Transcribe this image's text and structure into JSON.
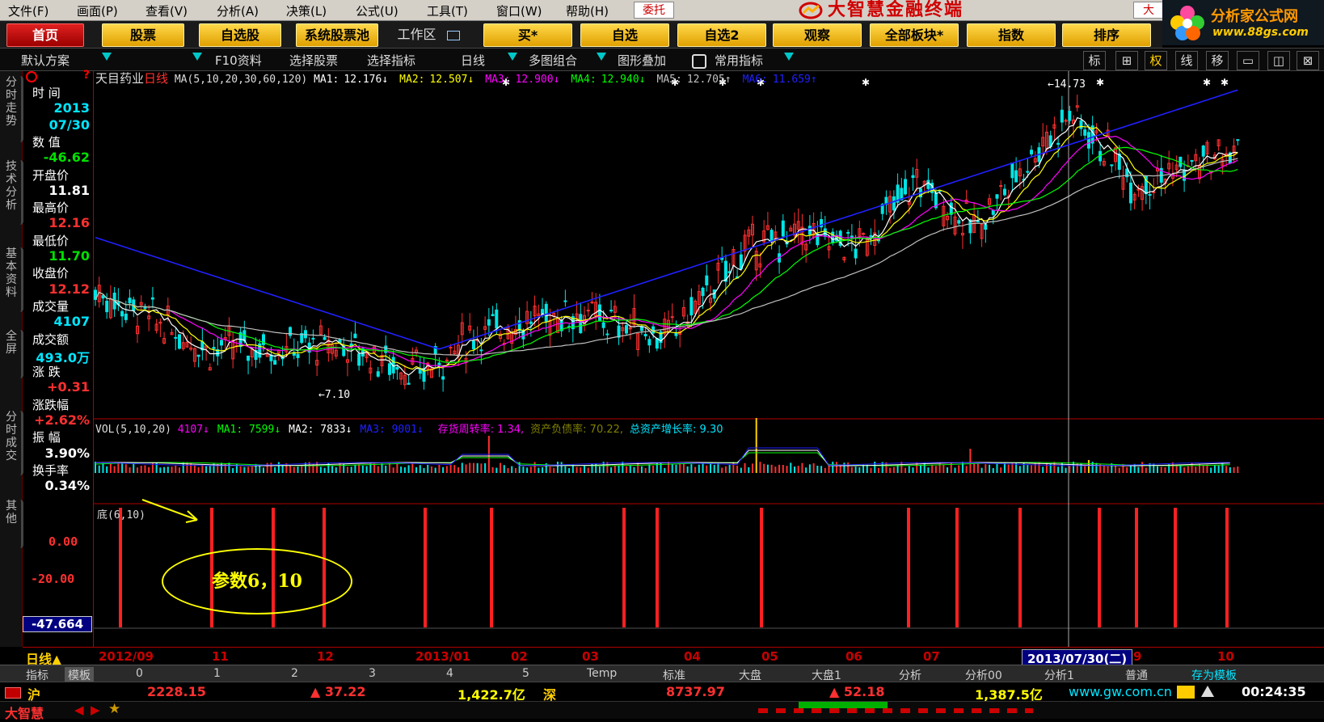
{
  "menu": [
    "文件(F)",
    "画面(P)",
    "查看(V)",
    "分析(A)",
    "决策(L)",
    "公式(U)",
    "工具(T)",
    "窗口(W)",
    "帮助(H)"
  ],
  "entrust_label": "委托",
  "brand_title": "大智慧金融终端",
  "corner_button": "大",
  "corner_logo": {
    "line1": "分析家公式网",
    "line2": "www.88gs.com"
  },
  "nav": {
    "home": "首页",
    "stocks": "股票",
    "watchlist": "自选股",
    "screener": "系统股票池",
    "workspace": "工作区",
    "buy": "买*",
    "self": "自选",
    "self2": "自选2",
    "watch": "观察",
    "sectors": "全部板块*",
    "index": "指数",
    "sort": "排序"
  },
  "toolbar": {
    "scheme": "默认方案",
    "f10": "F10资料",
    "select_stock": "选择股票",
    "select_indicator": "选择指标",
    "period": "日线",
    "multi": "多图组合",
    "overlay": "图形叠加",
    "common": "常用指标",
    "right_icons": [
      "标",
      "⊞",
      "权",
      "线",
      "移",
      "▭",
      "◫",
      "⊠"
    ]
  },
  "vtabs": [
    "分时走势",
    "技术分析",
    "基本资料",
    "全屏",
    "分时成交",
    "其他"
  ],
  "info": [
    {
      "label": "时  间",
      "value": ""
    },
    {
      "label": "",
      "value": "2013",
      "color": "#00e5ff"
    },
    {
      "label": "",
      "value": "07/30",
      "color": "#00e5ff"
    },
    {
      "label": "数  值",
      "value": ""
    },
    {
      "label": "",
      "value": "-46.62",
      "color": "#00e000"
    },
    {
      "label": "开盘价",
      "value": ""
    },
    {
      "label": "",
      "value": "11.81",
      "color": "#ffffff"
    },
    {
      "label": "最高价",
      "value": ""
    },
    {
      "label": "",
      "value": "12.16",
      "color": "#ff3030"
    },
    {
      "label": "最低价",
      "value": ""
    },
    {
      "label": "",
      "value": "11.70",
      "color": "#00e000"
    },
    {
      "label": "收盘价",
      "value": ""
    },
    {
      "label": "",
      "value": "12.12",
      "color": "#ff3030"
    },
    {
      "label": "成交量",
      "value": ""
    },
    {
      "label": "",
      "value": "4107",
      "color": "#00e5ff"
    },
    {
      "label": "成交额",
      "value": ""
    },
    {
      "label": "",
      "value": "493.0万",
      "color": "#00e5ff"
    },
    {
      "label": "涨  跌",
      "value": ""
    },
    {
      "label": "",
      "value": "+0.31",
      "color": "#ff3030"
    },
    {
      "label": "涨跌幅",
      "value": ""
    },
    {
      "label": "",
      "value": "+2.62%",
      "color": "#ff3030"
    },
    {
      "label": "振  幅",
      "value": "",
      "inline": true
    },
    {
      "label": "",
      "value": "3.90%",
      "color": "#ffffff"
    },
    {
      "label": "换手率",
      "value": ""
    },
    {
      "label": "",
      "value": "0.34%",
      "color": "#ffffff"
    }
  ],
  "chart": {
    "stock_name": "天目药业",
    "period": "日线",
    "ma_legend": "MA(5,10,20,30,60,120)",
    "ma_values": [
      {
        "label": "MA1:",
        "value": "12.176↓",
        "color": "#ffffff"
      },
      {
        "label": "MA2:",
        "value": "12.507↓",
        "color": "#ffff00"
      },
      {
        "label": "MA3:",
        "value": "12.900↓",
        "color": "#ff00ff"
      },
      {
        "label": "MA4:",
        "value": "12.940↓",
        "color": "#00ff00"
      },
      {
        "label": "MA5:",
        "value": "12.705↑",
        "color": "#c0c0c0"
      },
      {
        "label": "MA6:",
        "value": "11.659↑",
        "color": "#2020ff"
      }
    ],
    "high_mark": "14.73",
    "low_mark": "7.10",
    "vol_legend": "VOL(5,10,20)",
    "vol_values": [
      {
        "text": "4107↓",
        "color": "#ff00ff"
      },
      {
        "text": "MA1: 7599↓",
        "color": "#00ff00"
      },
      {
        "text": "MA2: 7833↓",
        "color": "#ffffff"
      },
      {
        "text": "MA3: 9001↓",
        "color": "#2020ff"
      }
    ],
    "fin_values": [
      {
        "text": "存货周转率: 1.34,",
        "color": "#ff00ff"
      },
      {
        "text": "资产负债率: 70.22,",
        "color": "#808000"
      },
      {
        "text": "总资产增长率: 9.30",
        "color": "#00e5ff"
      }
    ],
    "indicator_name": "底(6,10)",
    "indicator_ticks": [
      "0.00",
      "-20.00"
    ],
    "indicator_current": "-47.664",
    "annotation": "参数6，10"
  },
  "chart_data": {
    "type": "line",
    "title": "天目药业 日线",
    "x_range": [
      "2012/09",
      "2013/10"
    ],
    "y_range_price": [
      7.1,
      14.73
    ],
    "series": [
      {
        "name": "MA1",
        "color": "#ffffff"
      },
      {
        "name": "MA2",
        "color": "#ffff00"
      },
      {
        "name": "MA3",
        "color": "#ff00ff"
      },
      {
        "name": "MA4",
        "color": "#00ff00"
      },
      {
        "name": "MA5",
        "color": "#c0c0c0"
      },
      {
        "name": "MA6",
        "color": "#2020ff"
      }
    ],
    "signal_bars_months": [
      "2012/09",
      "2012/11",
      "2012/11",
      "2012/12",
      "2013/01",
      "2013/02",
      "2013/03",
      "2013/03",
      "2013/05",
      "2013/06",
      "2013/07",
      "2013/07",
      "2013/08",
      "2013/09",
      "2013/09",
      "2013/10"
    ]
  },
  "dateaxis": {
    "period_label": "日线",
    "ticks": [
      "2012/09",
      "11",
      "12",
      "2013/01",
      "02",
      "03",
      "04",
      "05",
      "06",
      "07",
      "2013/07/30(二)",
      "9",
      "10"
    ]
  },
  "tabs": [
    "指标",
    "模板",
    "0",
    "1",
    "2",
    "3",
    "4",
    "5",
    "Temp",
    "标准",
    "大盘",
    "大盘1",
    "分析",
    "分析00",
    "分析1",
    "普通",
    "存为模板"
  ],
  "status": {
    "sh_label": "沪",
    "sh_index": "2228.15",
    "sh_change": "▲ 37.22",
    "sh_amount": "1,422.7亿",
    "sz_label": "深",
    "sz_index": "8737.97",
    "sz_change": "▲ 52.18",
    "sz_amount": "1,387.5亿",
    "website": "www.gw.com.cn",
    "time": "00:24:35"
  },
  "brand_footer": "大智慧"
}
